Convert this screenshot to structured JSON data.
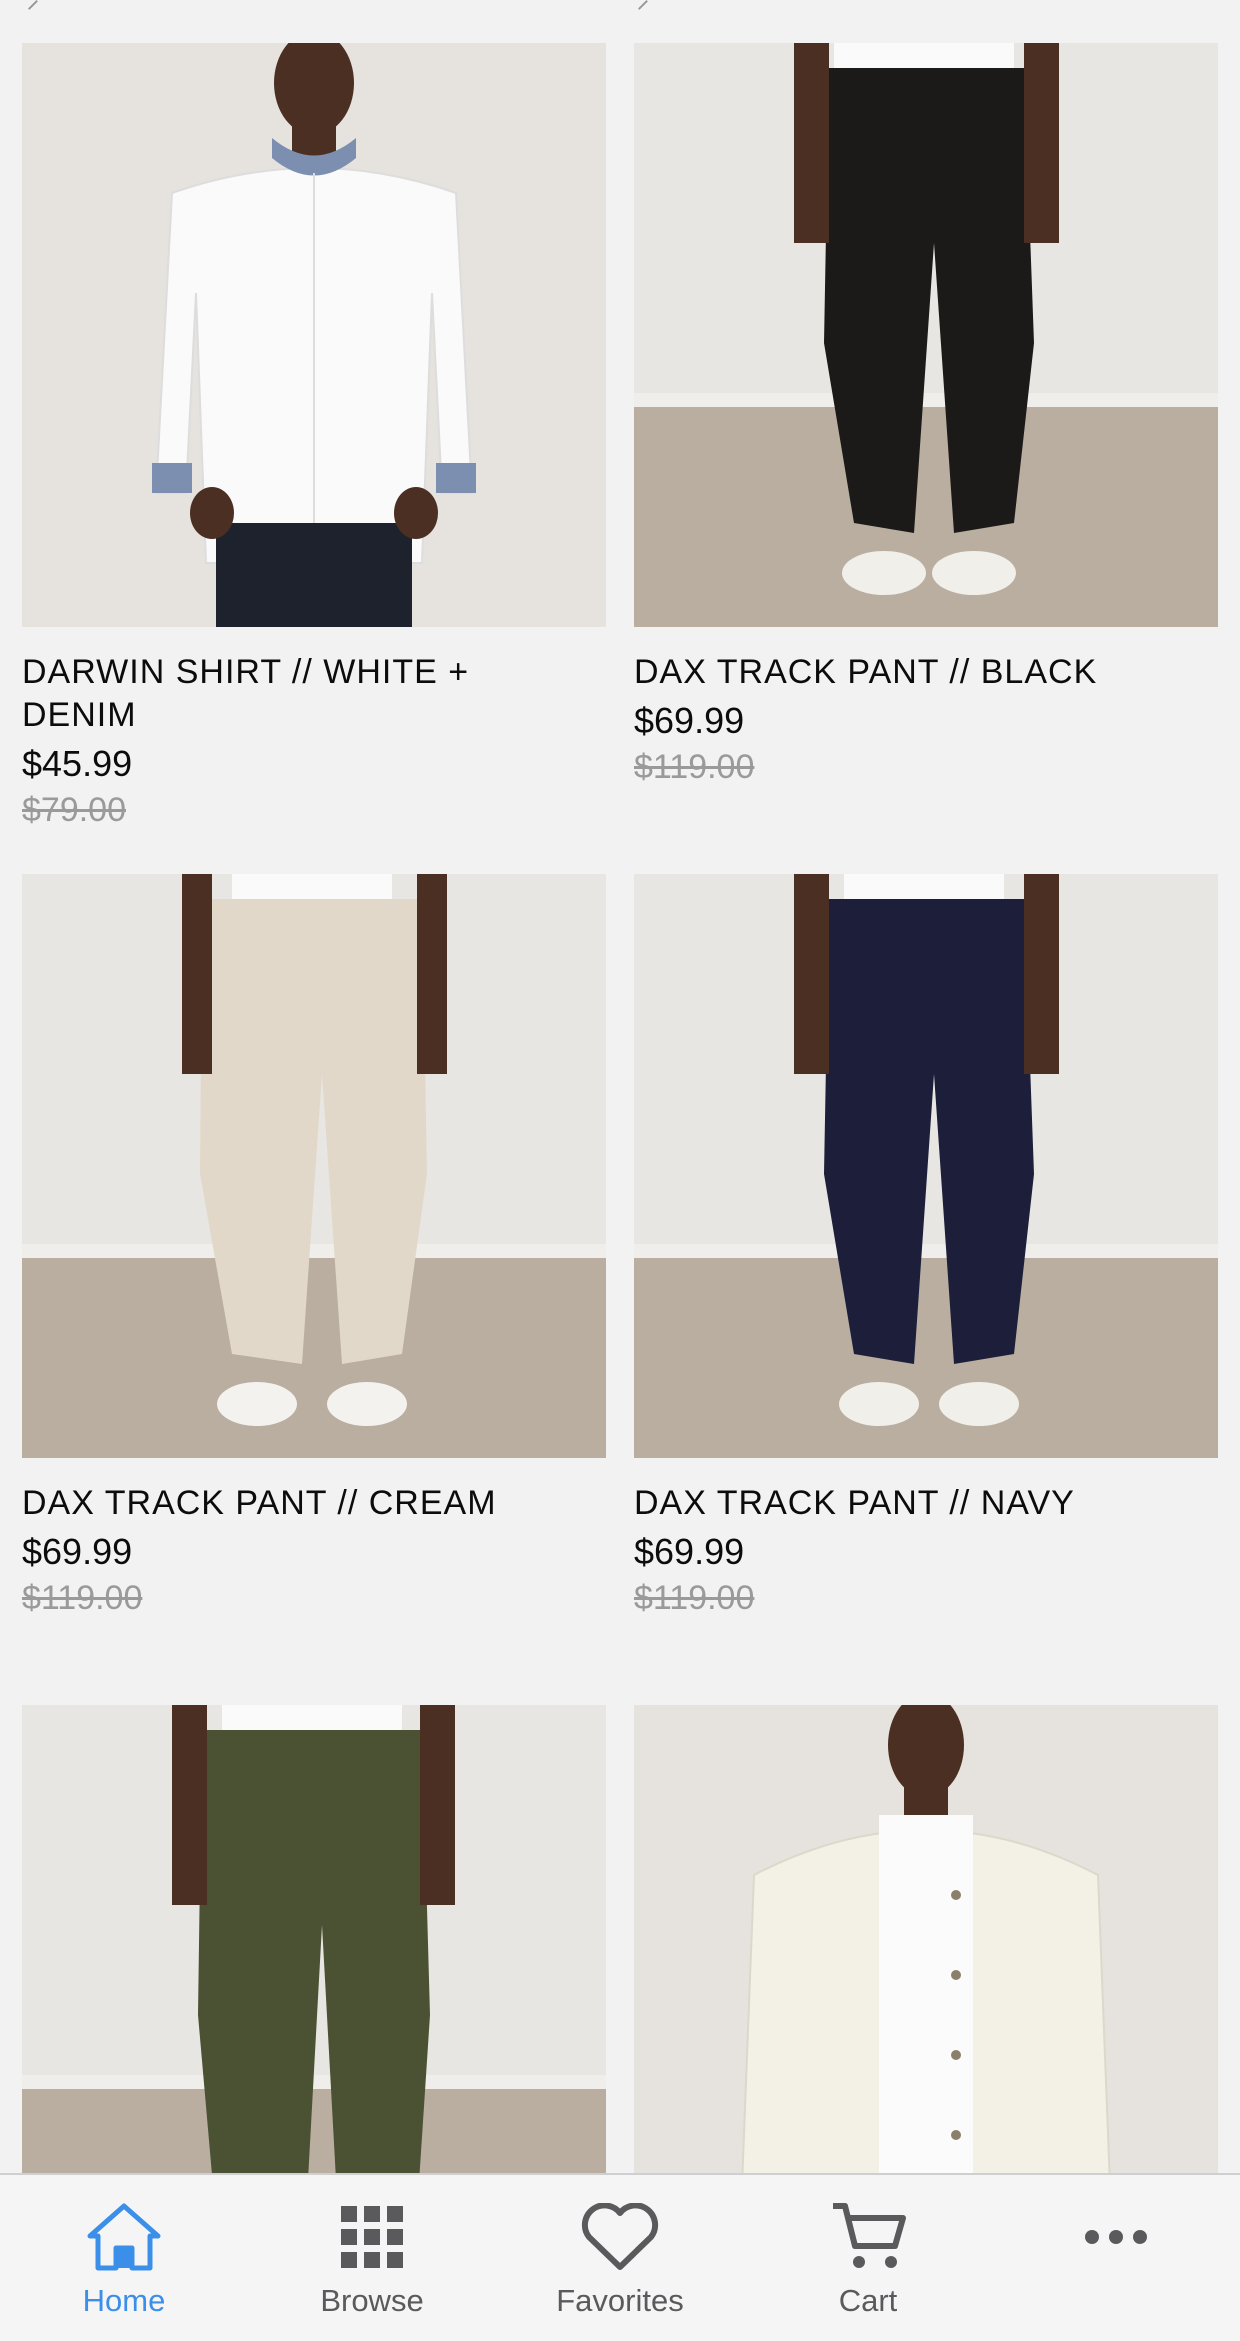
{
  "products": [
    {
      "title": "DARWIN SHIRT // WHITE + DENIM",
      "price": "$45.99",
      "original_price": "$79.00"
    },
    {
      "title": "DAX TRACK PANT // BLACK",
      "price": "$69.99",
      "original_price": "$119.00"
    },
    {
      "title": "DAX TRACK PANT // CREAM",
      "price": "$69.99",
      "original_price": "$119.00"
    },
    {
      "title": "DAX TRACK PANT // NAVY",
      "price": "$69.99",
      "original_price": "$119.00"
    },
    {
      "title": "",
      "price": "",
      "original_price": ""
    },
    {
      "title": "",
      "price": "",
      "original_price": ""
    }
  ],
  "tabbar": {
    "home": "Home",
    "browse": "Browse",
    "favorites": "Favorites",
    "cart": "Cart",
    "more_icon": "more-icon"
  },
  "colors": {
    "accent": "#3b8fe8",
    "inactive": "#5a5a5d",
    "background": "#f2f2f3"
  }
}
